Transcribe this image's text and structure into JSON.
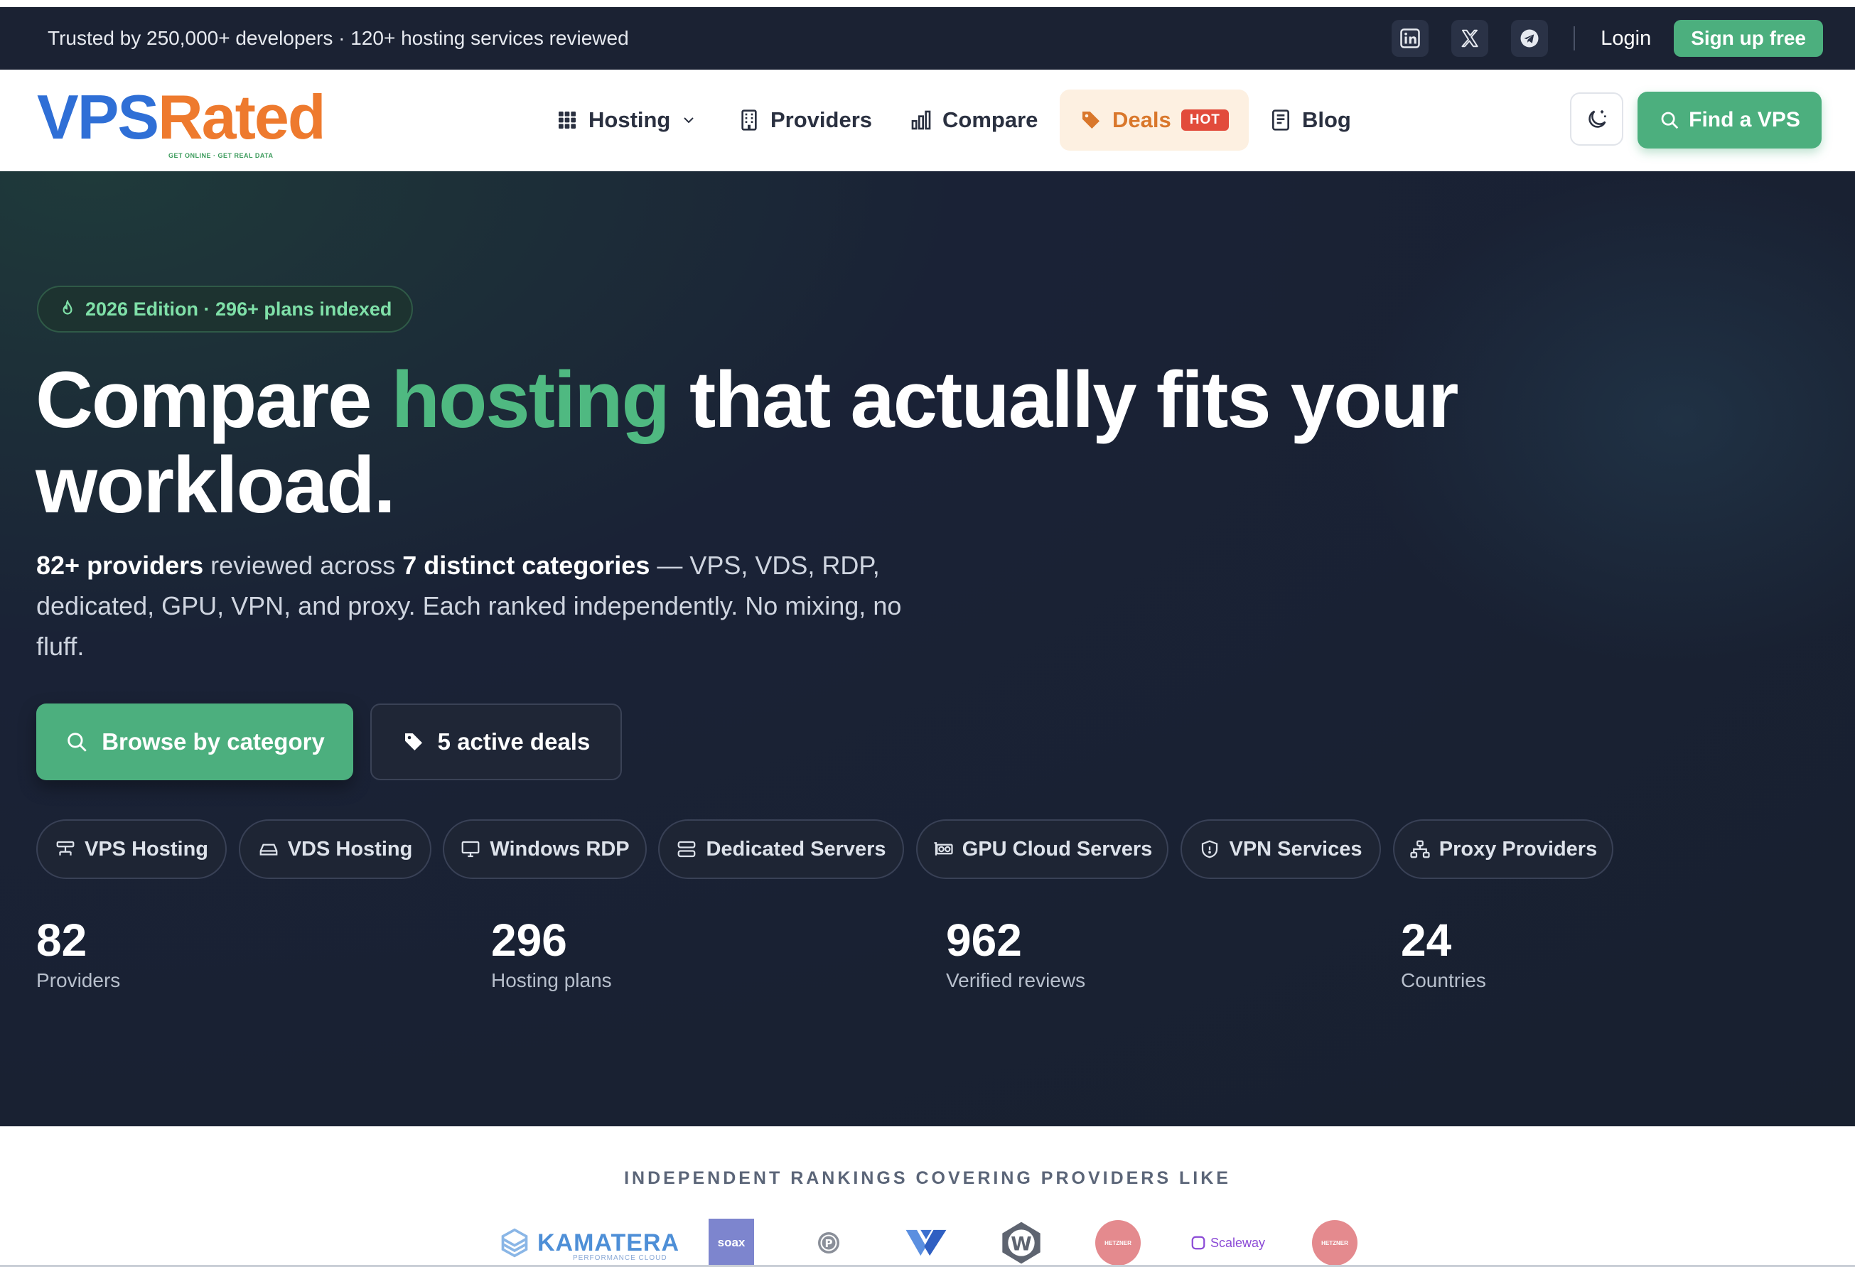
{
  "topbar": {
    "trust_text": "Trusted by 250,000+ developers · 120+ hosting services reviewed",
    "social": [
      "linkedin-icon",
      "x-icon",
      "telegram-icon"
    ],
    "login_label": "Login",
    "signup_label": "Sign up free"
  },
  "header": {
    "logo": {
      "part1": "VPS",
      "part2": "Rated",
      "tagline": "GET ONLINE · GET REAL DATA"
    },
    "nav": {
      "hosting": "Hosting",
      "providers": "Providers",
      "compare": "Compare",
      "deals": "Deals",
      "deals_badge": "HOT",
      "blog": "Blog"
    },
    "find_vps_label": "Find a VPS"
  },
  "hero": {
    "badge": "2026 Edition · 296+ plans indexed",
    "headline": {
      "part1": "Compare ",
      "accent": "hosting",
      "part2": " that actually fits your workload."
    },
    "lead": {
      "b1": "82+ providers",
      "t1": " reviewed across ",
      "b2": "7 distinct categories",
      "t2": " — VPS, VDS, RDP, dedicated, GPU, VPN, and proxy. Each ranked independently. No mixing, no fluff."
    },
    "cta_primary": "Browse by category",
    "cta_secondary": "5 active deals",
    "categories": [
      "VPS Hosting",
      "VDS Hosting",
      "Windows RDP",
      "Dedicated Servers",
      "GPU Cloud Servers",
      "VPN Services",
      "Proxy Providers"
    ],
    "stats": [
      {
        "value": "82",
        "label": "Providers"
      },
      {
        "value": "296",
        "label": "Hosting plans"
      },
      {
        "value": "962",
        "label": "Verified reviews"
      },
      {
        "value": "24",
        "label": "Countries"
      }
    ]
  },
  "providers_strip": {
    "title": "INDEPENDENT RANKINGS COVERING PROVIDERS LIKE",
    "kamatera": "KAMATERA",
    "kamatera_sub": "PERFORMANCE CLOUD",
    "soax": "soax",
    "scaleway": "Scaleway",
    "hetzner": "HETZNER"
  },
  "colors": {
    "accent": "#4caf7e",
    "brand_blue": "#2f6fd6",
    "brand_orange": "#ee7a2e",
    "dark_bg": "#1b2233"
  }
}
